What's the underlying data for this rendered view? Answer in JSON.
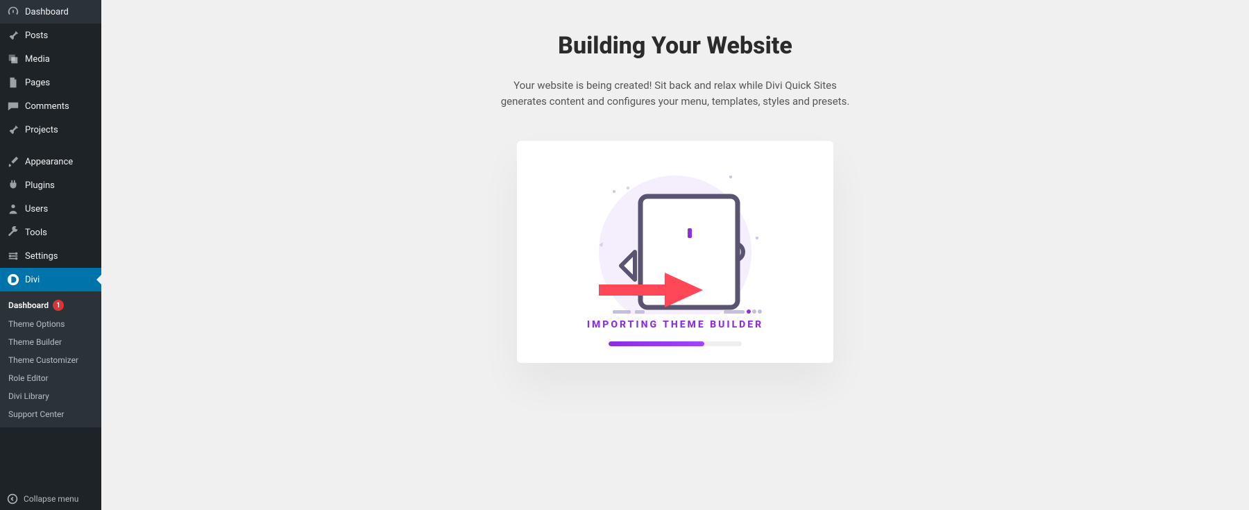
{
  "sidebar": {
    "items": [
      {
        "label": "Dashboard"
      },
      {
        "label": "Posts"
      },
      {
        "label": "Media"
      },
      {
        "label": "Pages"
      },
      {
        "label": "Comments"
      },
      {
        "label": "Projects"
      },
      {
        "label": "Appearance"
      },
      {
        "label": "Plugins"
      },
      {
        "label": "Users"
      },
      {
        "label": "Tools"
      },
      {
        "label": "Settings"
      },
      {
        "label": "Divi"
      }
    ],
    "submenu": [
      {
        "label": "Dashboard",
        "badge": "1"
      },
      {
        "label": "Theme Options"
      },
      {
        "label": "Theme Builder"
      },
      {
        "label": "Theme Customizer"
      },
      {
        "label": "Role Editor"
      },
      {
        "label": "Divi Library"
      },
      {
        "label": "Support Center"
      }
    ],
    "collapse_label": "Collapse menu"
  },
  "main": {
    "title": "Building Your Website",
    "subtitle": "Your website is being created! Sit back and relax while Divi Quick Sites generates content and configures your menu, templates, styles and presets.",
    "status": "IMPORTING THEME BUILDER",
    "progress_percent": 72
  },
  "colors": {
    "accent": "#0073aa",
    "progress": "#8E2DE2",
    "badge": "#d63638",
    "arrow": "#ff4757"
  }
}
